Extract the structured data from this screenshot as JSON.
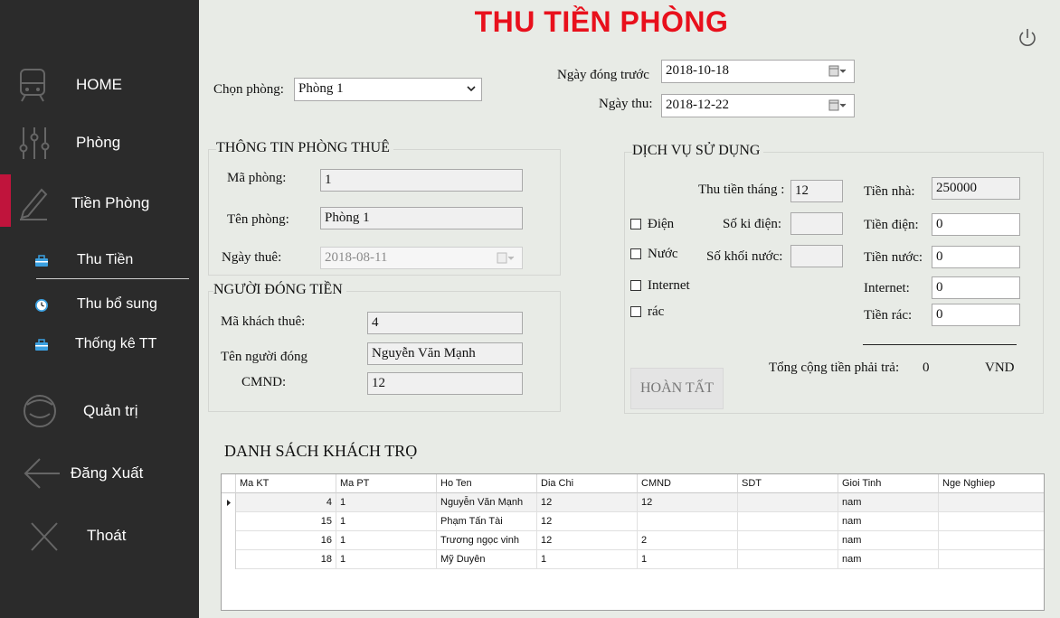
{
  "title": "THU TIỀN PHÒNG",
  "sidebar": {
    "items": [
      {
        "label": "HOME",
        "icon": "train-icon"
      },
      {
        "label": "Phòng",
        "icon": "sliders-icon"
      },
      {
        "label": "Tiền Phòng",
        "icon": "pen-icon"
      },
      {
        "label": "Quản trị",
        "icon": "user-helmet-icon"
      },
      {
        "label": "Đăng Xuất",
        "icon": "arrow-left-icon"
      },
      {
        "label": "Thoát",
        "icon": "close-icon"
      }
    ],
    "sub_items": [
      {
        "label": "Thu Tiền",
        "icon": "briefcase-icon"
      },
      {
        "label": "Thu bổ sung",
        "icon": "clock-icon"
      },
      {
        "label": "Thống kê TT",
        "icon": "briefcase-icon"
      }
    ],
    "accent": "#c0143c"
  },
  "top": {
    "room_label": "Chọn phòng:",
    "room_value": "Phòng 1",
    "prev_date_label": "Ngày đóng trước",
    "prev_date_value": "2018-10-18",
    "collect_date_label": "Ngày thu:",
    "collect_date_value": "2018-12-22"
  },
  "room_info": {
    "title": "THÔNG TIN PHÒNG THUÊ",
    "id_label": "Mã phòng:",
    "id_value": "1",
    "name_label": "Tên phòng:",
    "name_value": "Phòng 1",
    "rent_date_label": "Ngày thuê:",
    "rent_date_value": "2018-08-11"
  },
  "payer": {
    "title": "NGƯỜI ĐÓNG TIỀN",
    "tenant_id_label": "Mã khách thuê:",
    "tenant_id_value": "4",
    "payer_name_label": "Tên người đóng",
    "payer_name_value": "Nguyễn Văn Mạnh",
    "cmnd_label": "CMND:",
    "cmnd_value": "12"
  },
  "services": {
    "title": "DỊCH VỤ SỬ DỤNG",
    "months_label": "Thu tiền tháng :",
    "months_value": "12",
    "electric_label": "Điện",
    "electric_units_label": "Số ki điện:",
    "water_label": "Nước",
    "water_units_label": "Số khối nước:",
    "internet_label": "Internet",
    "trash_label": "rác",
    "rent_label": "Tiền nhà:",
    "rent_value": "250000",
    "electric_fee_label": "Tiền điện:",
    "electric_fee_value": "0",
    "water_fee_label": "Tiền nước:",
    "water_fee_value": "0",
    "internet_fee_label": "Internet:",
    "internet_fee_value": "0",
    "trash_fee_label": "Tiền rác:",
    "trash_fee_value": "0",
    "total_label": "Tổng cộng tiền phải trả:",
    "total_value": "0",
    "currency": "VND"
  },
  "done_button": "HOÀN TẤT",
  "list": {
    "title": "DANH SÁCH KHÁCH TRỌ",
    "columns": [
      "Ma KT",
      "Ma PT",
      "Ho Ten",
      "Dia Chi",
      "CMND",
      "SDT",
      "Gioi Tinh",
      "Nge Nghiep"
    ],
    "rows": [
      [
        "4",
        "1",
        "Nguyễn Văn Mạnh",
        "12",
        "12",
        "",
        "nam",
        ""
      ],
      [
        "15",
        "1",
        "Phạm Tấn Tài",
        "12",
        "",
        "",
        "nam",
        ""
      ],
      [
        "16",
        "1",
        "Trương ngọc vinh",
        "12",
        "2",
        "",
        "nam",
        ""
      ],
      [
        "18",
        "1",
        "Mỹ Duyên",
        "1",
        "1",
        "",
        "nam",
        ""
      ]
    ]
  }
}
